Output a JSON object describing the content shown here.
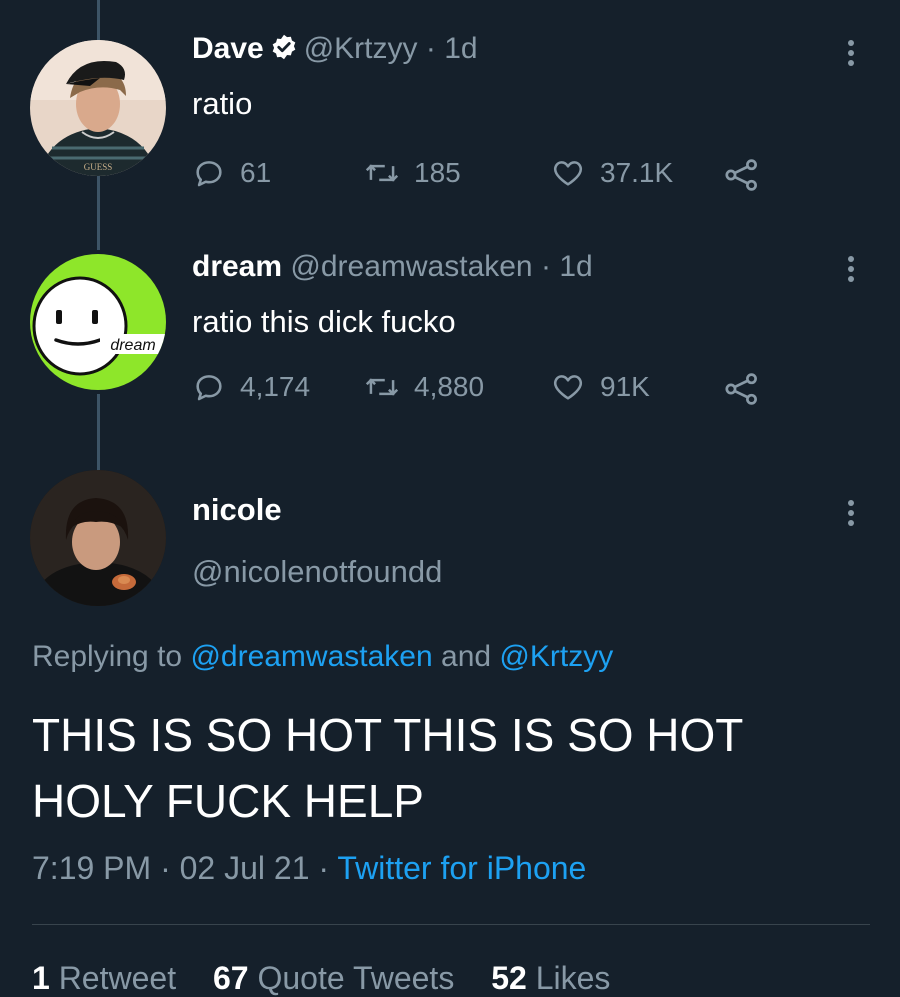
{
  "tweets": [
    {
      "name": "Dave",
      "verified": true,
      "handle": "@Krtzyy",
      "dot": "·",
      "time": "1d",
      "text": "ratio",
      "replies": "61",
      "retweets": "185",
      "likes": "37.1K",
      "avatar_text": "GUESS"
    },
    {
      "name": "dream",
      "verified": false,
      "handle": "@dreamwastaken",
      "dot": "·",
      "time": "1d",
      "text": "ratio this dick fucko",
      "replies": "4,174",
      "retweets": "4,880",
      "likes": "91K",
      "avatar_text": "dream"
    }
  ],
  "focus": {
    "name": "nicole",
    "handle": "@nicolenotfoundd",
    "replying_prefix": "Replying to",
    "mention1": "@dreamwastaken",
    "and": "and",
    "mention2": "@Krtzyy",
    "text": "THIS IS SO HOT THIS IS SO HOT HOLY FUCK HELP",
    "time": "7:19 PM",
    "sep": "·",
    "date": "02 Jul 21",
    "source": "Twitter for iPhone",
    "retweets_count": "1",
    "retweets_label": "Retweet",
    "quotes_count": "67",
    "quotes_label": "Quote Tweets",
    "likes_count": "52",
    "likes_label": "Likes"
  },
  "colors": {
    "background": "#15202b",
    "text": "#ffffff",
    "secondary": "#8899a6",
    "link": "#1da1f2",
    "verified": "#ffffff",
    "dream_green": "#8ee62a"
  }
}
